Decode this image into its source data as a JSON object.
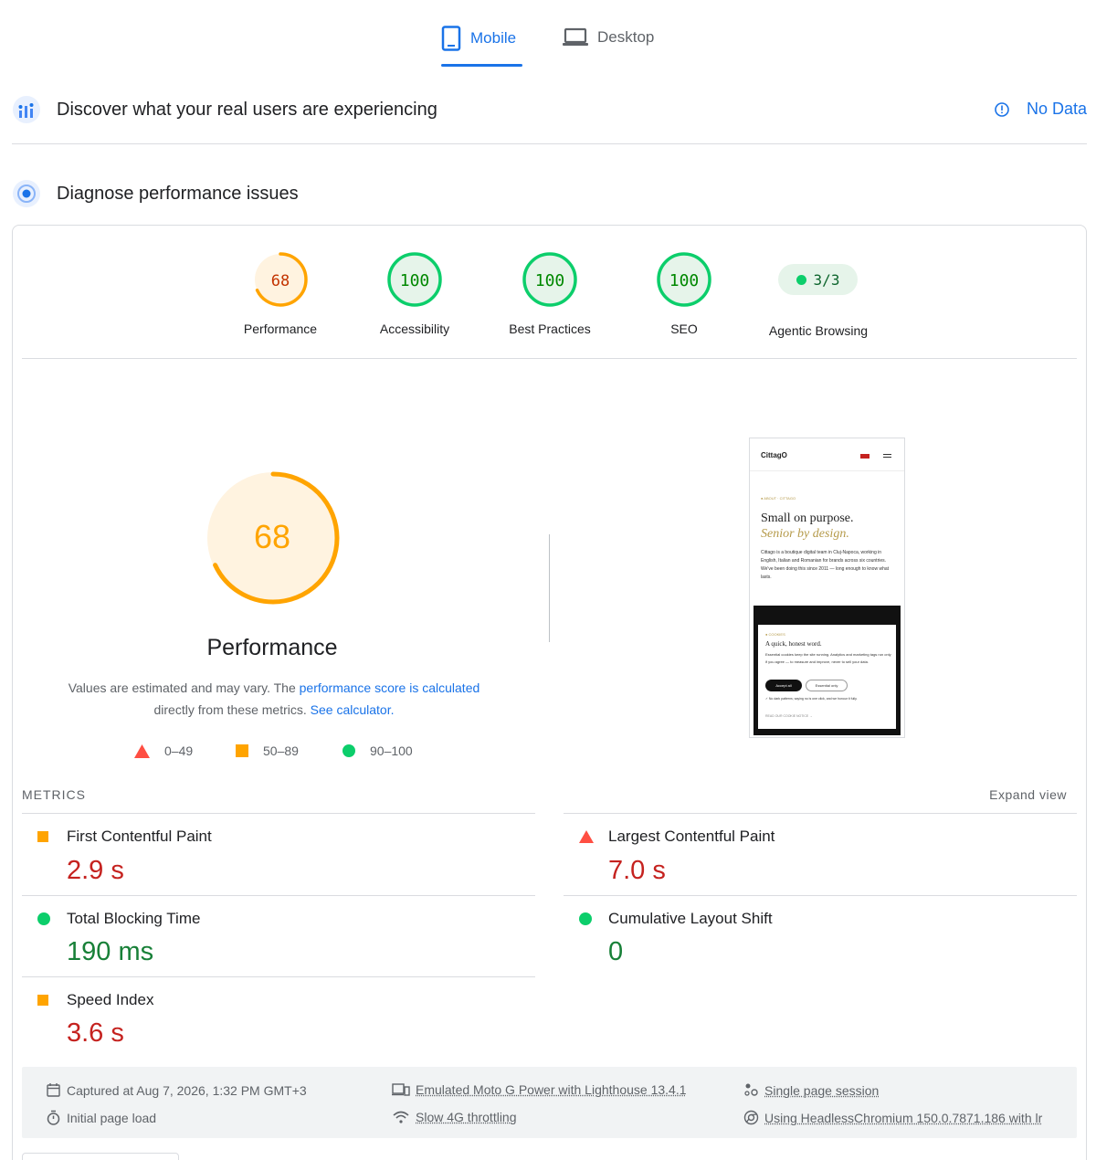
{
  "tabs": [
    {
      "label": "Mobile",
      "active": true
    },
    {
      "label": "Desktop",
      "active": false
    }
  ],
  "field_data": {
    "title": "Discover what your real users are experiencing",
    "status": "No Data"
  },
  "diagnose": {
    "title": "Diagnose performance issues"
  },
  "categories": [
    {
      "score": "68",
      "label": "Performance",
      "value": 68,
      "color": "#ffa400"
    },
    {
      "score": "100",
      "label": "Accessibility",
      "value": 100,
      "color": "#0cce6b"
    },
    {
      "score": "100",
      "label": "Best Practices",
      "value": 100,
      "color": "#0cce6b"
    },
    {
      "score": "100",
      "label": "SEO",
      "value": 100,
      "color": "#0cce6b"
    }
  ],
  "agentic": {
    "score": "3/3",
    "label": "Agentic Browsing"
  },
  "performance": {
    "score": "68",
    "value": 68,
    "title": "Performance",
    "desc_1": "Values are estimated and may vary. The ",
    "desc_link_1": "performance score is calculated",
    "desc_2": "directly from these metrics. ",
    "desc_link_2": "See calculator."
  },
  "legend": {
    "poor": "0–49",
    "average": "50–89",
    "good": "90–100"
  },
  "metrics": {
    "title": "METRICS",
    "expand": "Expand view",
    "fcp": {
      "name": "First Contentful Paint",
      "value": "2.9 s",
      "status": "average"
    },
    "lcp": {
      "name": "Largest Contentful Paint",
      "value": "7.0 s",
      "status": "poor"
    },
    "tbt": {
      "name": "Total Blocking Time",
      "value": "190 ms",
      "status": "good"
    },
    "cls": {
      "name": "Cumulative Layout Shift",
      "value": "0",
      "status": "good"
    },
    "si": {
      "name": "Speed Index",
      "value": "3.6 s",
      "status": "average"
    }
  },
  "footer": {
    "captured": "Captured at Aug 7, 2026, 1:32 PM GMT+3",
    "initial": "Initial page load",
    "device": "Emulated Moto G Power with Lighthouse 13.4.1",
    "throttling": "Slow 4G throttling",
    "session": "Single page session",
    "browser": "Using HeadlessChromium 150.0.7871.186 with lr"
  },
  "screenshot": {
    "brand": "CittagO",
    "eyebrow": "● ABOUT · CITTAGO",
    "headline_1": "Small on purpose.",
    "headline_2": "Senior by design.",
    "body": "Cittago is a boutique digital team in Cluj-Napoca, working in English, Italian and Romanian for brands across six countries. We've been doing this since 2011 — long enough to know what lasts.",
    "cookie_eyebrow": "● COOKIES",
    "cookie_title": "A quick, honest word.",
    "cookie_body": "Essential cookies keep the site running. Analytics and marketing tags run only if you agree — to measure and improve, never to sell your data.",
    "accept": "Accept all",
    "essential": "Essential only",
    "fine": "✓ No dark patterns; saying no is one click, and we honour it fully.",
    "link": "READ OUR COOKIE NOTICE →"
  },
  "colors": {
    "accent": "#1a73e8",
    "good": "#0cce6b",
    "average": "#ffa400",
    "poor": "#ff4e42"
  }
}
